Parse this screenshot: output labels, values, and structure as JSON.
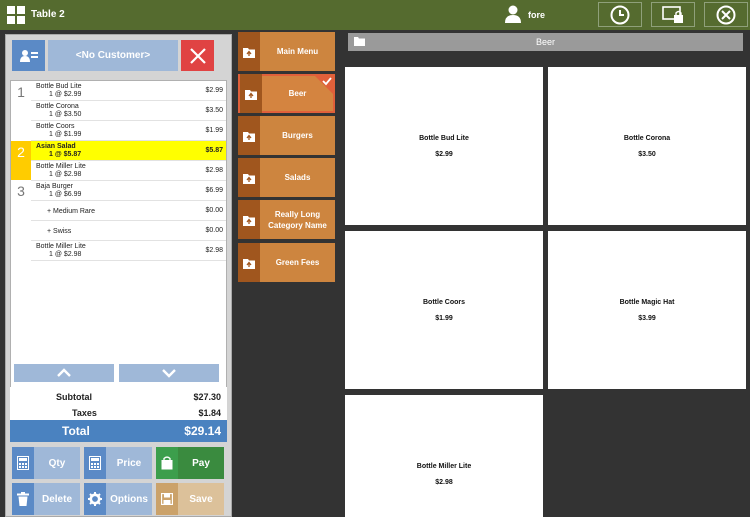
{
  "header": {
    "title": "Table 2",
    "user": "fore",
    "icons": {
      "app": "grid-icon",
      "user": "user-icon",
      "clock": "clock-icon",
      "lock": "screen-lock-icon",
      "close": "close-icon"
    }
  },
  "customer": {
    "label": "<No Customer>"
  },
  "order": {
    "seats": [
      "1",
      "2",
      "3"
    ],
    "items": [
      {
        "name": "Bottle Bud Lite",
        "qty": "1 @ $2.99",
        "price": "$2.99"
      },
      {
        "name": "Bottle Corona",
        "qty": "1 @ $3.50",
        "price": "$3.50"
      },
      {
        "name": "Bottle Coors",
        "qty": "1 @ $1.99",
        "price": "$1.99"
      },
      {
        "name": "Asian Salad",
        "qty": "1 @ $5.87",
        "price": "$5.87"
      },
      {
        "name": "Bottle Miller Lite",
        "qty": "1 @ $2.98",
        "price": "$2.98"
      },
      {
        "name": "Baja Burger",
        "qty": "1 @ $6.99",
        "price": "$6.99"
      },
      {
        "name": "+ Medium Rare",
        "qty": "",
        "price": "$0.00"
      },
      {
        "name": "+ Swiss",
        "qty": "",
        "price": "$0.00"
      },
      {
        "name": "Bottle Miller Lite",
        "qty": "1 @ $2.98",
        "price": "$2.98"
      }
    ]
  },
  "totals": {
    "subtotal_label": "Subtotal",
    "subtotal": "$27.30",
    "taxes_label": "Taxes",
    "taxes": "$1.84",
    "total_label": "Total",
    "total": "$29.14"
  },
  "actions": {
    "qty": "Qty",
    "price": "Price",
    "pay": "Pay",
    "delete": "Delete",
    "options": "Options",
    "save": "Save"
  },
  "categories": [
    {
      "label": "Main Menu",
      "active": false
    },
    {
      "label": "Beer",
      "active": true
    },
    {
      "label": "Burgers",
      "active": false
    },
    {
      "label": "Salads",
      "active": false
    },
    {
      "label": "Really Long Category Name",
      "active": false
    },
    {
      "label": "Green Fees",
      "active": false
    }
  ],
  "breadcrumb": "Beer",
  "products": [
    {
      "name": "Bottle Bud Lite",
      "price": "$2.99"
    },
    {
      "name": "Bottle Corona",
      "price": "$3.50"
    },
    {
      "name": "Bottle Coors",
      "price": "$1.99"
    },
    {
      "name": "Bottle Magic Hat",
      "price": "$3.99"
    },
    {
      "name": "Bottle Miller Lite",
      "price": "$2.98"
    }
  ],
  "colors": {
    "topbar": "#556b2f",
    "category": "#cd853f",
    "highlight": "#ffff00",
    "total_bar": "#4a82c0"
  }
}
